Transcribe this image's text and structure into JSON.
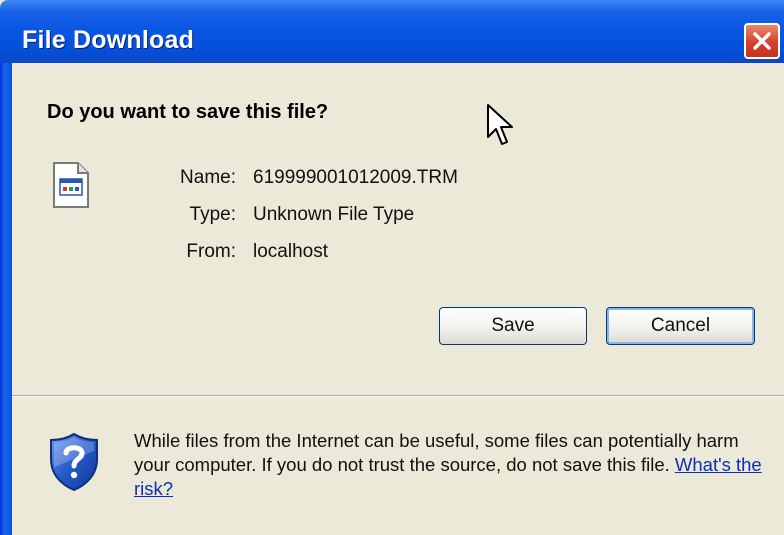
{
  "window": {
    "title": "File Download",
    "close_label": "Close"
  },
  "dialog": {
    "question": "Do you want to save this file?",
    "fields": {
      "name_label": "Name:",
      "name_value": "619999001012009.TRM",
      "type_label": "Type:",
      "type_value": "Unknown File Type",
      "from_label": "From:",
      "from_value": "localhost"
    },
    "buttons": {
      "save": "Save",
      "cancel": "Cancel"
    },
    "warning": {
      "text": "While files from the Internet can be useful, some files can potentially harm your computer. If you do not trust the source, do not save this file.",
      "link": "What's the risk?"
    }
  },
  "icons": {
    "file": "file-icon",
    "shield": "shield-help-icon",
    "cursor": "mouse-cursor-icon",
    "close": "close-icon"
  },
  "colors": {
    "titlebar": "#0452dc",
    "dialog_background": "#ece9d8",
    "close_button": "#d6402a",
    "link": "#0b2fb8"
  }
}
